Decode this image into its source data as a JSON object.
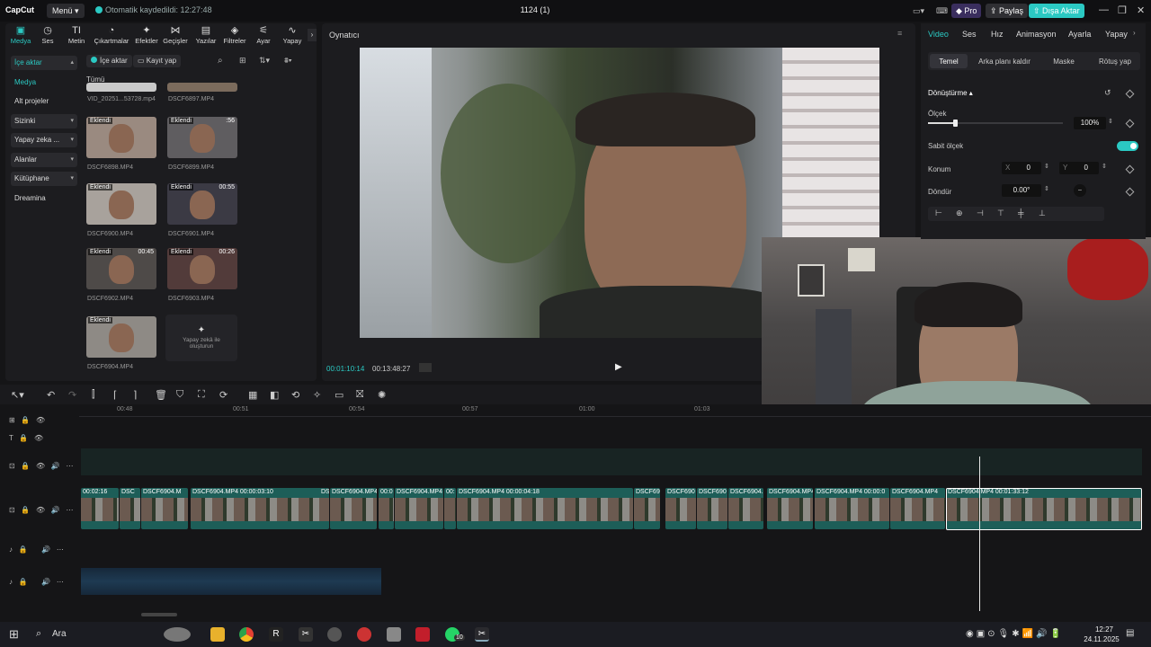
{
  "titlebar": {
    "logo": "CapCut",
    "menu_label": "Menü ▾",
    "autosave": "Otomatik kaydedildi: 12:27:48",
    "project_title": "1124 (1)",
    "pro_label": "Pro",
    "share_label": "Paylaş",
    "export_label": "Dışa Aktar"
  },
  "left": {
    "tool_tabs": [
      {
        "label": "Medya",
        "icon": "▣"
      },
      {
        "label": "Ses",
        "icon": "◷"
      },
      {
        "label": "Metin",
        "icon": "TI"
      },
      {
        "label": "Çıkartmalar",
        "icon": "◔"
      },
      {
        "label": "Efektler",
        "icon": "✦"
      },
      {
        "label": "Geçişler",
        "icon": "⋈"
      },
      {
        "label": "Yazılar",
        "icon": "▤"
      },
      {
        "label": "Filtreler",
        "icon": "◈"
      },
      {
        "label": "Ayar",
        "icon": "⚟"
      },
      {
        "label": "Yapay",
        "icon": "∿"
      }
    ],
    "side_nav": [
      {
        "label": "İçe aktar",
        "chev": "▴"
      },
      {
        "label": "Medya",
        "chev": ""
      },
      {
        "label": "Alt projeler",
        "chev": ""
      },
      {
        "label": "Sizinki",
        "chev": "▾"
      },
      {
        "label": "Yapay zeka ...",
        "chev": "▾"
      },
      {
        "label": "Alanlar",
        "chev": "▾"
      },
      {
        "label": "Kütüphane",
        "chev": "▾"
      },
      {
        "label": "Dreamina",
        "chev": ""
      }
    ],
    "import_label": "İçe aktar",
    "record_label": "Kayıt yap",
    "filter_all": "Tümü",
    "media_items": [
      {
        "name": "VID_20251...53728.mp4",
        "badge": "",
        "duration": ""
      },
      {
        "name": "DSCF6897.MP4",
        "badge": "",
        "duration": ""
      },
      {
        "name": "DSCF6898.MP4",
        "badge": "Eklendi",
        "duration": ""
      },
      {
        "name": "DSCF6899.MP4",
        "badge": "Eklendi",
        "duration": ":56"
      },
      {
        "name": "DSCF6900.MP4",
        "badge": "Eklendi",
        "duration": ""
      },
      {
        "name": "DSCF6901.MP4",
        "badge": "Eklendi",
        "duration": "00:55"
      },
      {
        "name": "DSCF6902.MP4",
        "badge": "Eklendi",
        "duration": "00:45"
      },
      {
        "name": "DSCF6903.MP4",
        "badge": "Eklendi",
        "duration": "00:26"
      },
      {
        "name": "DSCF6904.MP4",
        "badge": "Eklendi",
        "duration": ""
      }
    ],
    "ai_create_label": "Yapay zekâ ile oluşturun"
  },
  "player": {
    "title": "Oynatıcı",
    "current_time": "00:01:10:14",
    "total_time": "00:13:48:27"
  },
  "right": {
    "tabs": [
      "Video",
      "Ses",
      "Hız",
      "Animasyon",
      "Ayarla",
      "Yapay"
    ],
    "subtabs": [
      "Temel",
      "Arka planı kaldır",
      "Maske",
      "Rötuş yap"
    ],
    "section_title": "Dönüştürme",
    "scale_label": "Ölçek",
    "scale_value": "100%",
    "scale_fraction": 1.0,
    "uniform_scale_label": "Sabit ölçek",
    "position_label": "Konum",
    "pos_x_label": "X",
    "pos_x": "0",
    "pos_y_label": "Y",
    "pos_y": "0",
    "rotate_label": "Döndür",
    "rotate_value": "0.00°"
  },
  "timeline": {
    "ruler": [
      "00:48",
      "00:51",
      "00:54",
      "00:57",
      "01:00",
      "01:03"
    ],
    "clips": [
      {
        "label": "00:02:16"
      },
      {
        "label": "DSC"
      },
      {
        "label": "DSCF6904.M"
      },
      {
        "label": "DSCF6904.MP4  00:00:03:10"
      },
      {
        "label": "DS"
      },
      {
        "label": "DSCF6904.MP4"
      },
      {
        "label": "00:0"
      },
      {
        "label": "DSCF6904.MP4"
      },
      {
        "label": "00:"
      },
      {
        "label": "DSCF6904.MP4  00:00:04:18"
      },
      {
        "label": "DSCF690"
      },
      {
        "label": "DSCF690"
      },
      {
        "label": "DSCF690"
      },
      {
        "label": "DSCF6904."
      },
      {
        "label": "DSCF6904.MP4"
      },
      {
        "label": "DSCF6904.MP4  00:00:0"
      },
      {
        "label": "DSCF6904.MP4"
      },
      {
        "label": "DSCF6904.MP4  00:01:33:12"
      }
    ]
  },
  "taskbar": {
    "search_label": "Ara",
    "time": "12:27",
    "date": "24.11.2025",
    "whatsapp_count": "10"
  }
}
